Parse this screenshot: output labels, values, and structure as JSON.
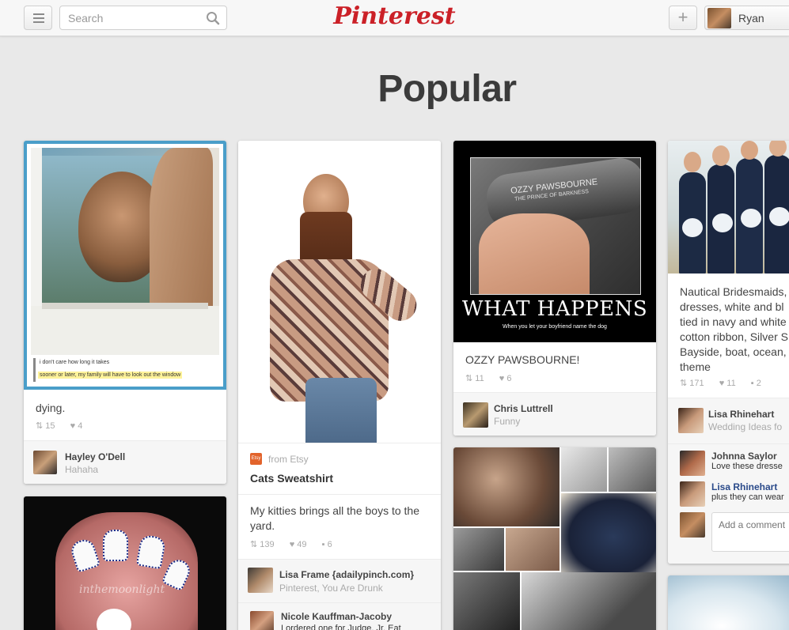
{
  "header": {
    "search_placeholder": "Search",
    "logo": "Pinterest",
    "add_label": "+",
    "user_name": "Ryan"
  },
  "page_title": "Popular",
  "pins": [
    {
      "image_captions": [
        "i don't care how long it takes",
        "sooner or later, my family will have to look out the window"
      ],
      "description": "dying.",
      "repins": "15",
      "likes": "4",
      "pinner": {
        "name": "Hayley O'Dell",
        "board": "Hahaha"
      }
    },
    {
      "source_label": "from Etsy",
      "title": "Cats Sweatshirt",
      "description": "My kitties brings all the boys to the yard.",
      "repins": "139",
      "likes": "49",
      "comments": "6",
      "pinner": {
        "name": "Lisa Frame {adailypinch.com}",
        "board": "Pinterest, You Are Drunk"
      },
      "comment": {
        "name": "Nicole Kauffman-Jacoby",
        "text": "I ordered one for Judge. Jr. Eat"
      }
    },
    {
      "tag_line1": "OZZY PAWSBOURNE",
      "tag_line2": "THE PRINCE OF BARKNESS",
      "poster_title": "WHAT HAPPENS",
      "poster_sub": "When you let your boyfriend name the dog",
      "description": "OZZY PAWSBOURNE!",
      "repins": "11",
      "likes": "6",
      "pinner": {
        "name": "Chris Luttrell",
        "board": "Funny"
      }
    },
    {
      "description": "Nautical Bridesmaids, dresses, white and bl tied in navy and white cotton ribbon, Silver S Bayside, boat, ocean, theme",
      "description_lines": [
        "Nautical Bridesmaids,",
        "dresses, white and bl",
        "tied in navy and white",
        "cotton ribbon, Silver S",
        "Bayside, boat, ocean,",
        "theme"
      ],
      "repins": "171",
      "likes": "11",
      "comments": "2",
      "pinner": {
        "name": "Lisa Rhinehart",
        "board": "Wedding Ideas fo"
      },
      "comment_list": [
        {
          "name": "Johnna Saylor",
          "text": "Love these dresse"
        },
        {
          "name": "Lisa Rhinehart",
          "text": "plus they can wear"
        }
      ],
      "add_comment_placeholder": "Add a comment"
    }
  ],
  "nail_watermark": "inthemoonlight"
}
